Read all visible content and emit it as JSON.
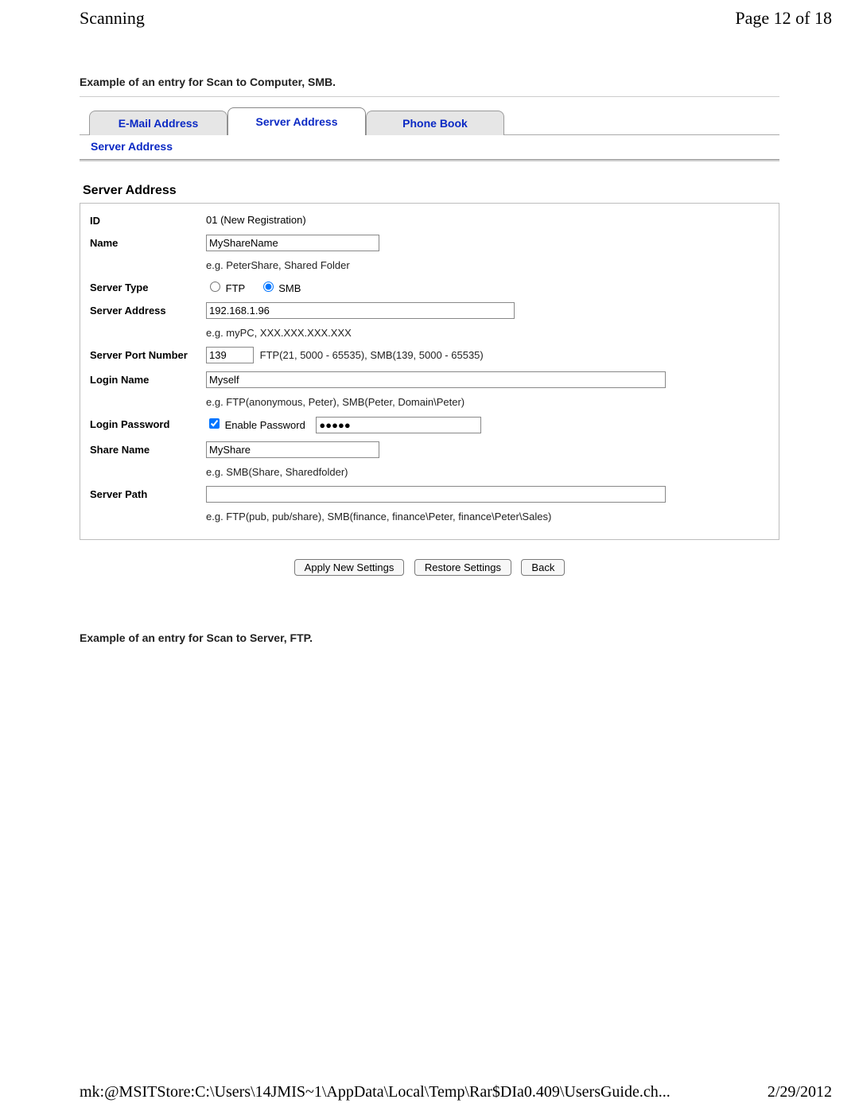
{
  "header": {
    "title": "Scanning",
    "pagination": "Page 12 of 18"
  },
  "intro_top": "Example of an entry for Scan to Computer, SMB.",
  "tabs": {
    "email": "E-Mail Address",
    "server": "Server Address",
    "phone": "Phone Book"
  },
  "breadcrumb": "Server Address",
  "section_title": "Server Address",
  "form": {
    "id_label": "ID",
    "id_value": "01 (New Registration)",
    "name_label": "Name",
    "name_value": "MyShareName",
    "name_hint": "e.g. PeterShare, Shared Folder",
    "server_type_label": "Server Type",
    "server_type_ftp": "FTP",
    "server_type_smb": "SMB",
    "server_address_label": "Server Address",
    "server_address_value": "192.168.1.96",
    "server_address_hint": "e.g. myPC, XXX.XXX.XXX.XXX",
    "server_port_label": "Server Port Number",
    "server_port_value": "139",
    "server_port_hint": "FTP(21, 5000 - 65535), SMB(139, 5000 - 65535)",
    "login_name_label": "Login Name",
    "login_name_value": "Myself",
    "login_name_hint": "e.g. FTP(anonymous, Peter), SMB(Peter, Domain\\Peter)",
    "login_password_label": "Login Password",
    "enable_password_label": "Enable Password",
    "password_value": "●●●●●",
    "share_name_label": "Share Name",
    "share_name_value": "MyShare",
    "share_name_hint": "e.g. SMB(Share, Sharedfolder)",
    "server_path_label": "Server Path",
    "server_path_value": "",
    "server_path_hint": "e.g. FTP(pub, pub/share), SMB(finance, finance\\Peter, finance\\Peter\\Sales)"
  },
  "buttons": {
    "apply": "Apply New Settings",
    "restore": "Restore Settings",
    "back": "Back"
  },
  "intro_bottom": "Example of an entry for Scan to Server, FTP.",
  "footer": {
    "path": "mk:@MSITStore:C:\\Users\\14JMIS~1\\AppData\\Local\\Temp\\Rar$DIa0.409\\UsersGuide.ch...",
    "date": "2/29/2012"
  }
}
